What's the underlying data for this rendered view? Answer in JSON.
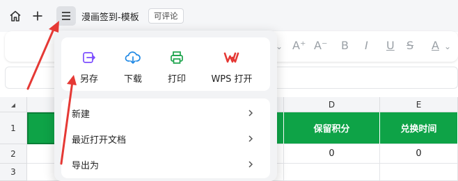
{
  "topbar": {
    "home_icon": "home-icon",
    "add_icon": "plus-icon",
    "menu_icon": "hamburger-menu-icon",
    "doc_title": "漫画签到-模板",
    "comment_tag": "可评论"
  },
  "toolbar": {
    "glyphs": [
      "A⁺",
      "A⁻",
      "B",
      "I",
      "U",
      "S",
      "A"
    ]
  },
  "sheet": {
    "columns": [
      {
        "label": "D"
      },
      {
        "label": "E"
      }
    ],
    "rows": [
      "1",
      "2",
      "3"
    ],
    "header_cells": [
      "保留积分",
      "兑换时间"
    ],
    "row2_cells": [
      "0",
      "0"
    ]
  },
  "menu": {
    "quick_actions": [
      {
        "label": "另存",
        "icon": "save-as-icon",
        "color": "#7c4dff"
      },
      {
        "label": "下载",
        "icon": "cloud-download-icon",
        "color": "#1e88e5"
      },
      {
        "label": "打印",
        "icon": "printer-icon",
        "color": "#1aa34a"
      },
      {
        "label": "WPS 打开",
        "icon": "wps-logo-icon",
        "color": "#e53935"
      }
    ],
    "items": [
      {
        "label": "新建"
      },
      {
        "label": "最近打开文档"
      },
      {
        "label": "导出为"
      }
    ]
  },
  "colors": {
    "accent_green": "#0ea347",
    "annotation_arrow": "#e53935"
  }
}
